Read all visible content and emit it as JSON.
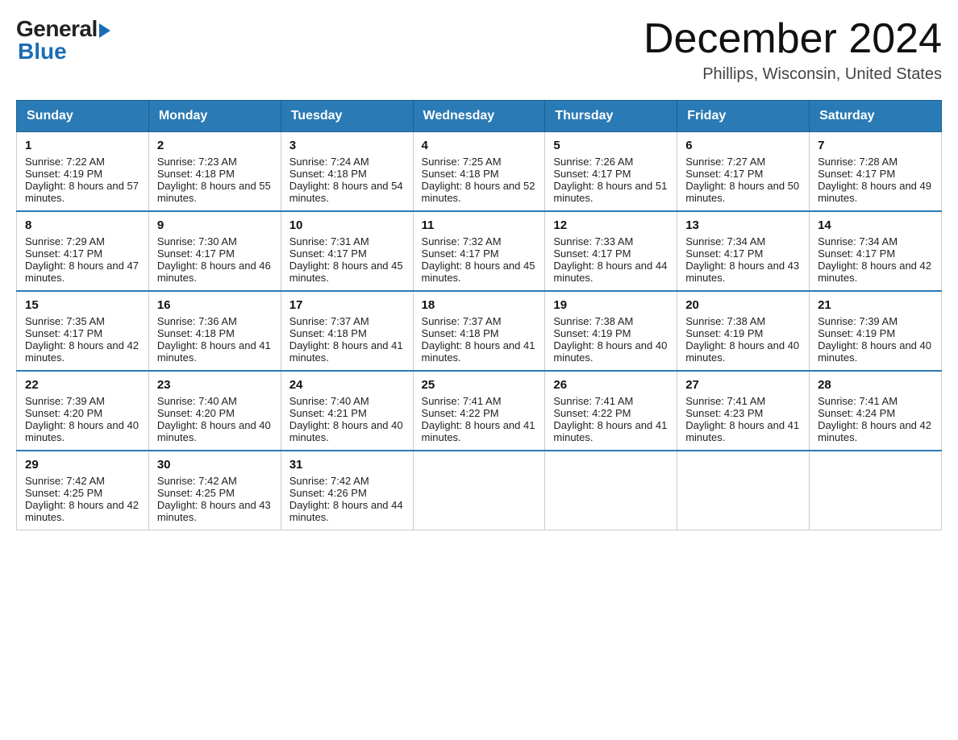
{
  "header": {
    "logo_general": "General",
    "logo_blue": "Blue",
    "month_year": "December 2024",
    "location": "Phillips, Wisconsin, United States"
  },
  "days_of_week": [
    "Sunday",
    "Monday",
    "Tuesday",
    "Wednesday",
    "Thursday",
    "Friday",
    "Saturday"
  ],
  "weeks": [
    [
      {
        "day": "1",
        "sunrise": "7:22 AM",
        "sunset": "4:19 PM",
        "daylight": "8 hours and 57 minutes."
      },
      {
        "day": "2",
        "sunrise": "7:23 AM",
        "sunset": "4:18 PM",
        "daylight": "8 hours and 55 minutes."
      },
      {
        "day": "3",
        "sunrise": "7:24 AM",
        "sunset": "4:18 PM",
        "daylight": "8 hours and 54 minutes."
      },
      {
        "day": "4",
        "sunrise": "7:25 AM",
        "sunset": "4:18 PM",
        "daylight": "8 hours and 52 minutes."
      },
      {
        "day": "5",
        "sunrise": "7:26 AM",
        "sunset": "4:17 PM",
        "daylight": "8 hours and 51 minutes."
      },
      {
        "day": "6",
        "sunrise": "7:27 AM",
        "sunset": "4:17 PM",
        "daylight": "8 hours and 50 minutes."
      },
      {
        "day": "7",
        "sunrise": "7:28 AM",
        "sunset": "4:17 PM",
        "daylight": "8 hours and 49 minutes."
      }
    ],
    [
      {
        "day": "8",
        "sunrise": "7:29 AM",
        "sunset": "4:17 PM",
        "daylight": "8 hours and 47 minutes."
      },
      {
        "day": "9",
        "sunrise": "7:30 AM",
        "sunset": "4:17 PM",
        "daylight": "8 hours and 46 minutes."
      },
      {
        "day": "10",
        "sunrise": "7:31 AM",
        "sunset": "4:17 PM",
        "daylight": "8 hours and 45 minutes."
      },
      {
        "day": "11",
        "sunrise": "7:32 AM",
        "sunset": "4:17 PM",
        "daylight": "8 hours and 45 minutes."
      },
      {
        "day": "12",
        "sunrise": "7:33 AM",
        "sunset": "4:17 PM",
        "daylight": "8 hours and 44 minutes."
      },
      {
        "day": "13",
        "sunrise": "7:34 AM",
        "sunset": "4:17 PM",
        "daylight": "8 hours and 43 minutes."
      },
      {
        "day": "14",
        "sunrise": "7:34 AM",
        "sunset": "4:17 PM",
        "daylight": "8 hours and 42 minutes."
      }
    ],
    [
      {
        "day": "15",
        "sunrise": "7:35 AM",
        "sunset": "4:17 PM",
        "daylight": "8 hours and 42 minutes."
      },
      {
        "day": "16",
        "sunrise": "7:36 AM",
        "sunset": "4:18 PM",
        "daylight": "8 hours and 41 minutes."
      },
      {
        "day": "17",
        "sunrise": "7:37 AM",
        "sunset": "4:18 PM",
        "daylight": "8 hours and 41 minutes."
      },
      {
        "day": "18",
        "sunrise": "7:37 AM",
        "sunset": "4:18 PM",
        "daylight": "8 hours and 41 minutes."
      },
      {
        "day": "19",
        "sunrise": "7:38 AM",
        "sunset": "4:19 PM",
        "daylight": "8 hours and 40 minutes."
      },
      {
        "day": "20",
        "sunrise": "7:38 AM",
        "sunset": "4:19 PM",
        "daylight": "8 hours and 40 minutes."
      },
      {
        "day": "21",
        "sunrise": "7:39 AM",
        "sunset": "4:19 PM",
        "daylight": "8 hours and 40 minutes."
      }
    ],
    [
      {
        "day": "22",
        "sunrise": "7:39 AM",
        "sunset": "4:20 PM",
        "daylight": "8 hours and 40 minutes."
      },
      {
        "day": "23",
        "sunrise": "7:40 AM",
        "sunset": "4:20 PM",
        "daylight": "8 hours and 40 minutes."
      },
      {
        "day": "24",
        "sunrise": "7:40 AM",
        "sunset": "4:21 PM",
        "daylight": "8 hours and 40 minutes."
      },
      {
        "day": "25",
        "sunrise": "7:41 AM",
        "sunset": "4:22 PM",
        "daylight": "8 hours and 41 minutes."
      },
      {
        "day": "26",
        "sunrise": "7:41 AM",
        "sunset": "4:22 PM",
        "daylight": "8 hours and 41 minutes."
      },
      {
        "day": "27",
        "sunrise": "7:41 AM",
        "sunset": "4:23 PM",
        "daylight": "8 hours and 41 minutes."
      },
      {
        "day": "28",
        "sunrise": "7:41 AM",
        "sunset": "4:24 PM",
        "daylight": "8 hours and 42 minutes."
      }
    ],
    [
      {
        "day": "29",
        "sunrise": "7:42 AM",
        "sunset": "4:25 PM",
        "daylight": "8 hours and 42 minutes."
      },
      {
        "day": "30",
        "sunrise": "7:42 AM",
        "sunset": "4:25 PM",
        "daylight": "8 hours and 43 minutes."
      },
      {
        "day": "31",
        "sunrise": "7:42 AM",
        "sunset": "4:26 PM",
        "daylight": "8 hours and 44 minutes."
      },
      null,
      null,
      null,
      null
    ]
  ],
  "labels": {
    "sunrise": "Sunrise:",
    "sunset": "Sunset:",
    "daylight": "Daylight:"
  }
}
